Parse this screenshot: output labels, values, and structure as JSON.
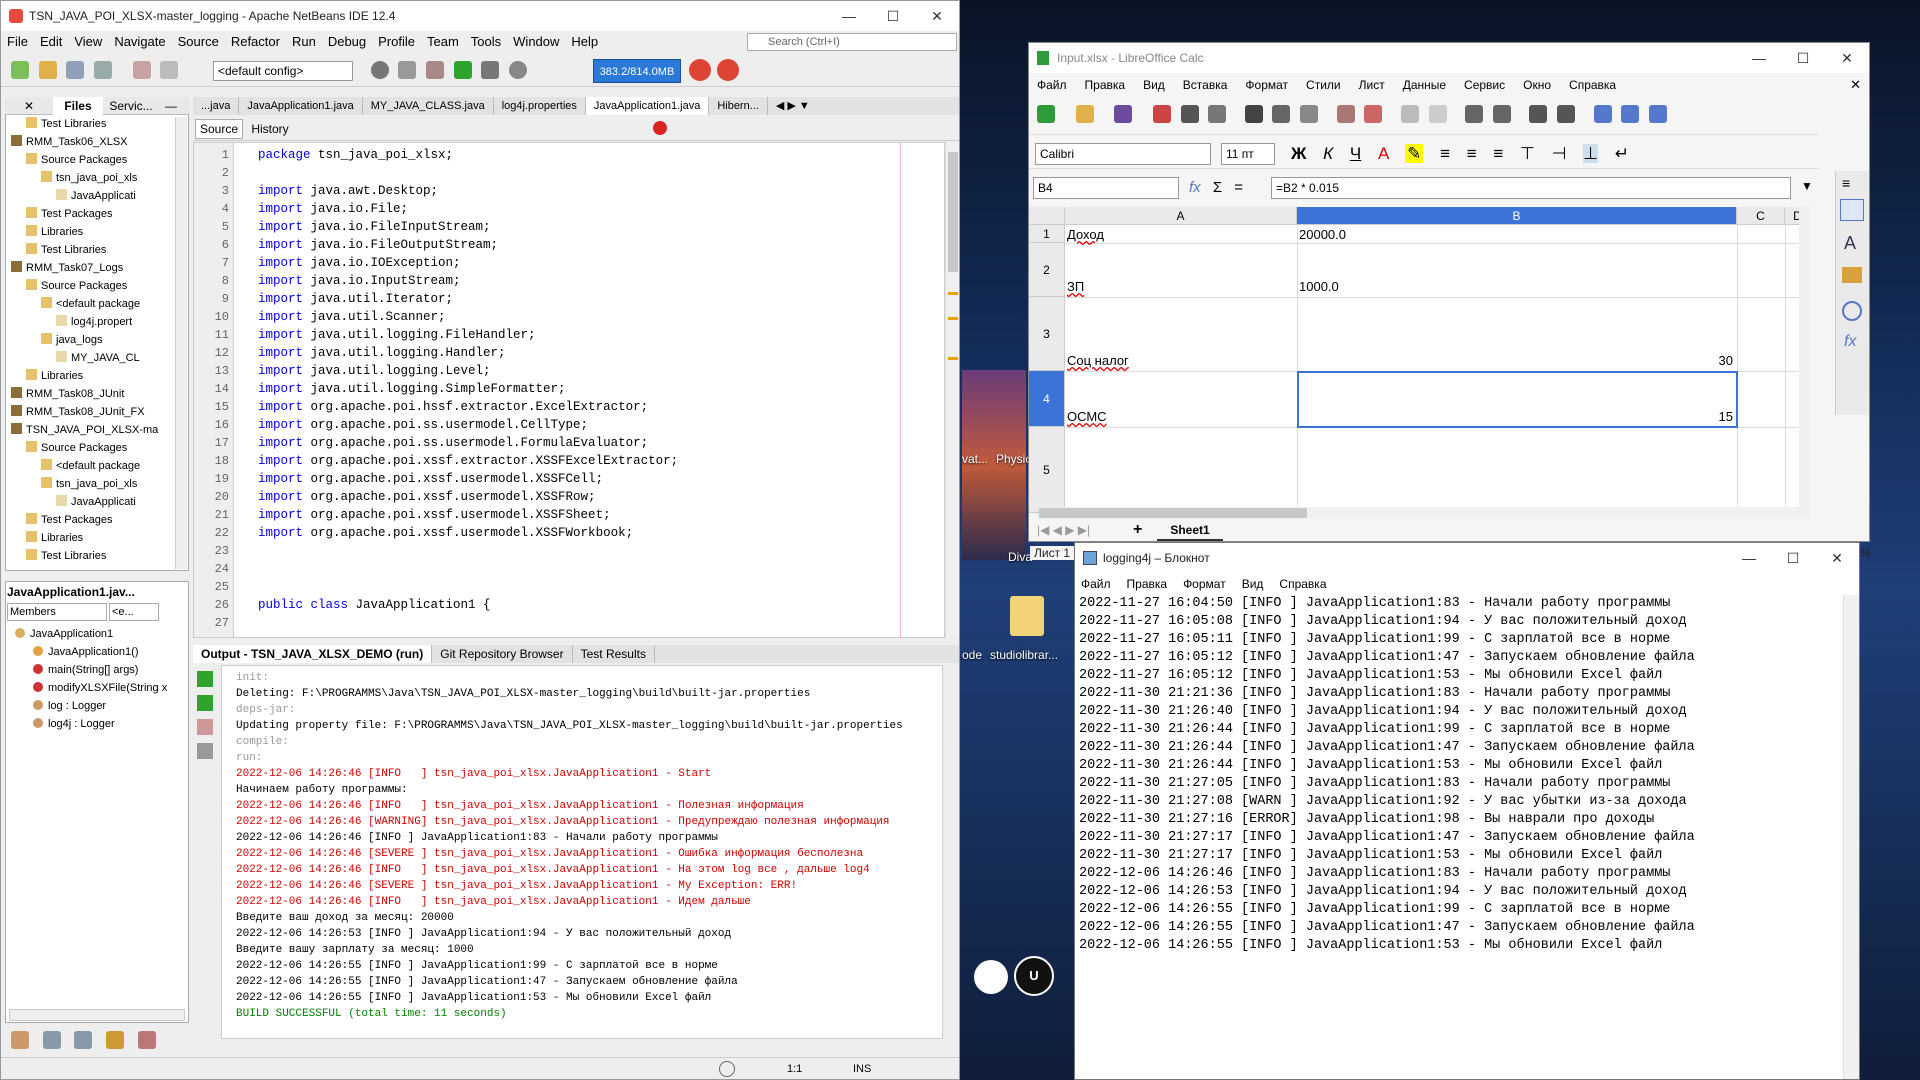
{
  "netbeans": {
    "title": "TSN_JAVA_POI_XLSX-master_logging - Apache NetBeans IDE 12.4",
    "menu": [
      "File",
      "Edit",
      "View",
      "Navigate",
      "Source",
      "Refactor",
      "Run",
      "Debug",
      "Profile",
      "Team",
      "Tools",
      "Window",
      "Help"
    ],
    "search_placeholder": "Search (Ctrl+I)",
    "config": "<default config>",
    "memory": "383.2/814.0MB",
    "project_tabs": [
      "Files",
      "Servic..."
    ],
    "tree": [
      "Test Libraries",
      "RMM_Task06_XLSX",
      "Source Packages",
      "tsn_java_poi_xls",
      "JavaApplicati",
      "Test Packages",
      "Libraries",
      "Test Libraries",
      "RMM_Task07_Logs",
      "Source Packages",
      "<default package",
      "log4j.propert",
      "java_logs",
      "MY_JAVA_CL",
      "Libraries",
      "RMM_Task08_JUnit",
      "RMM_Task08_JUnit_FX",
      "TSN_JAVA_POI_XLSX-ma",
      "Source Packages",
      "<default package",
      "tsn_java_poi_xls",
      "JavaApplicati",
      "Test Packages",
      "Libraries",
      "Test Libraries"
    ],
    "navigator_title": "JavaApplication1.jav...",
    "navigator_filter": "Members",
    "navigator_filter2": "<e...",
    "navigator_items": [
      "JavaApplication1",
      "JavaApplication1()",
      "main(String[] args)",
      "modifyXLSXFile(String x",
      "log : Logger",
      "log4j : Logger"
    ],
    "editor_tabs": [
      "...java",
      "JavaApplication1.java",
      "MY_JAVA_CLASS.java",
      "log4j.properties",
      "JavaApplication1.java",
      "Hibern..."
    ],
    "editor_modes": [
      "Source",
      "History"
    ],
    "line_numbers": [
      "1",
      "2",
      "3",
      "4",
      "5",
      "6",
      "7",
      "8",
      "9",
      "10",
      "11",
      "12",
      "13",
      "14",
      "15",
      "16",
      "17",
      "18",
      "19",
      "20",
      "21",
      "22",
      "23",
      "24",
      "25",
      "26",
      "27"
    ],
    "code_lines": [
      "package tsn_java_poi_xlsx;",
      "",
      "import java.awt.Desktop;",
      "import java.io.File;",
      "import java.io.FileInputStream;",
      "import java.io.FileOutputStream;",
      "import java.io.IOException;",
      "import java.io.InputStream;",
      "import java.util.Iterator;",
      "import java.util.Scanner;",
      "import java.util.logging.FileHandler;",
      "import java.util.logging.Handler;",
      "import java.util.logging.Level;",
      "import java.util.logging.SimpleFormatter;",
      "import org.apache.poi.hssf.extractor.ExcelExtractor;",
      "import org.apache.poi.ss.usermodel.CellType;",
      "import org.apache.poi.ss.usermodel.FormulaEvaluator;",
      "import org.apache.poi.xssf.extractor.XSSFExcelExtractor;",
      "import org.apache.poi.xssf.usermodel.XSSFCell;",
      "import org.apache.poi.xssf.usermodel.XSSFRow;",
      "import org.apache.poi.xssf.usermodel.XSSFSheet;",
      "import org.apache.poi.xssf.usermodel.XSSFWorkbook;",
      "",
      "",
      "",
      "public class JavaApplication1 {",
      ""
    ],
    "output_tabs": [
      "Output - TSN_JAVA_XLSX_DEMO (run)",
      "Git Repository Browser",
      "Test Results"
    ],
    "output_lines": [
      {
        "t": "init:",
        "c": "#999"
      },
      {
        "t": "Deleting: F:\\PROGRAMMS\\Java\\TSN_JAVA_POI_XLSX-master_logging\\build\\built-jar.properties",
        "c": "#000"
      },
      {
        "t": "deps-jar:",
        "c": "#999"
      },
      {
        "t": "Updating property file: F:\\PROGRAMMS\\Java\\TSN_JAVA_POI_XLSX-master_logging\\build\\built-jar.properties",
        "c": "#000"
      },
      {
        "t": "compile:",
        "c": "#999"
      },
      {
        "t": "run:",
        "c": "#999"
      },
      {
        "t": "2022-12-06 14:26:46 [INFO   ] tsn_java_poi_xlsx.JavaApplication1 - Start",
        "c": "#d40000"
      },
      {
        "t": "Начинаем работу программы:",
        "c": "#000"
      },
      {
        "t": "2022-12-06 14:26:46 [INFO   ] tsn_java_poi_xlsx.JavaApplication1 - Полезная информация",
        "c": "#d40000"
      },
      {
        "t": "2022-12-06 14:26:46 [WARNING] tsn_java_poi_xlsx.JavaApplication1 - Предупреждаю полезная информация",
        "c": "#d40000"
      },
      {
        "t": "2022-12-06 14:26:46 [INFO ] JavaApplication1:83 - Начали работу программы",
        "c": "#000"
      },
      {
        "t": "2022-12-06 14:26:46 [SEVERE ] tsn_java_poi_xlsx.JavaApplication1 - Ошибка информация бесполезна",
        "c": "#d40000"
      },
      {
        "t": "2022-12-06 14:26:46 [INFO   ] tsn_java_poi_xlsx.JavaApplication1 - На этом log все , дальше log4",
        "c": "#d40000"
      },
      {
        "t": "2022-12-06 14:26:46 [SEVERE ] tsn_java_poi_xlsx.JavaApplication1 - My Exception: ERR!",
        "c": "#d40000"
      },
      {
        "t": "2022-12-06 14:26:46 [INFO   ] tsn_java_poi_xlsx.JavaApplication1 - Идем дальше",
        "c": "#d40000"
      },
      {
        "t": "Введите ваш доход за месяц: 20000",
        "c": "#000"
      },
      {
        "t": "2022-12-06 14:26:53 [INFO ] JavaApplication1:94 - У вас положительный доход",
        "c": "#000"
      },
      {
        "t": "Введите вашу зарплату за месяц: 1000",
        "c": "#000"
      },
      {
        "t": "2022-12-06 14:26:55 [INFO ] JavaApplication1:99 - С зарплатой все в норме",
        "c": "#000"
      },
      {
        "t": "2022-12-06 14:26:55 [INFO ] JavaApplication1:47 - Запускаем обновление файла",
        "c": "#000"
      },
      {
        "t": "2022-12-06 14:26:55 [INFO ] JavaApplication1:53 - Мы обновили Excel файл",
        "c": "#000"
      },
      {
        "t": "BUILD SUCCESSFUL (total time: 11 seconds)",
        "c": "#008000"
      }
    ],
    "status_pos": "1:1",
    "status_mode": "INS"
  },
  "desktop": {
    "labels": [
      "vat...",
      "Physic",
      "Diva",
      "ode",
      "studiolibrar..."
    ]
  },
  "calc": {
    "title": "Input.xlsx - LibreOffice Calc",
    "menu": [
      "Файл",
      "Правка",
      "Вид",
      "Вставка",
      "Формат",
      "Стили",
      "Лист",
      "Данные",
      "Сервис",
      "Окно",
      "Справка"
    ],
    "font": "Calibri",
    "size": "11 пт",
    "namebox": "B4",
    "formula": "=B2 * 0.015",
    "col_headers": [
      "A",
      "B",
      "C",
      "D"
    ],
    "row_headers": [
      "1",
      "2",
      "3",
      "4",
      "5"
    ],
    "cells": {
      "a1": "Доход",
      "b1": "20000.0",
      "a2": "ЗП",
      "b2": "1000.0",
      "a3": "Соц налог",
      "b3": "30",
      "a4": "ОСМС",
      "b4": "15"
    },
    "sheet_tab": "Sheet1",
    "sheet_status": "Лист 1",
    "zoom_tail": "%"
  },
  "notepad": {
    "title": "logging4j – Блокнот",
    "menu": [
      "Файл",
      "Правка",
      "Формат",
      "Вид",
      "Справка"
    ],
    "lines": [
      "2022-11-27 16:04:50 [INFO ] JavaApplication1:83 - Начали работу программы",
      "2022-11-27 16:05:08 [INFO ] JavaApplication1:94 - У вас положительный доход",
      "2022-11-27 16:05:11 [INFO ] JavaApplication1:99 - С зарплатой все в норме",
      "2022-11-27 16:05:12 [INFO ] JavaApplication1:47 - Запускаем обновление файла",
      "2022-11-27 16:05:12 [INFO ] JavaApplication1:53 - Мы обновили Excel файл",
      "2022-11-30 21:21:36 [INFO ] JavaApplication1:83 - Начали работу программы",
      "2022-11-30 21:26:40 [INFO ] JavaApplication1:94 - У вас положительный доход",
      "2022-11-30 21:26:44 [INFO ] JavaApplication1:99 - С зарплатой все в норме",
      "2022-11-30 21:26:44 [INFO ] JavaApplication1:47 - Запускаем обновление файла",
      "2022-11-30 21:26:44 [INFO ] JavaApplication1:53 - Мы обновили Excel файл",
      "2022-11-30 21:27:05 [INFO ] JavaApplication1:83 - Начали работу программы",
      "2022-11-30 21:27:08 [WARN ] JavaApplication1:92 - У вас убытки из-за дохода",
      "2022-11-30 21:27:16 [ERROR] JavaApplication1:98 - Вы наврали про доходы",
      "2022-11-30 21:27:17 [INFO ] JavaApplication1:47 - Запускаем обновление файла",
      "2022-11-30 21:27:17 [INFO ] JavaApplication1:53 - Мы обновили Excel файл",
      "2022-12-06 14:26:46 [INFO ] JavaApplication1:83 - Начали работу программы",
      "2022-12-06 14:26:53 [INFO ] JavaApplication1:94 - У вас положительный доход",
      "2022-12-06 14:26:55 [INFO ] JavaApplication1:99 - С зарплатой все в норме",
      "2022-12-06 14:26:55 [INFO ] JavaApplication1:47 - Запускаем обновление файла",
      "2022-12-06 14:26:55 [INFO ] JavaApplication1:53 - Мы обновили Excel файл"
    ]
  }
}
